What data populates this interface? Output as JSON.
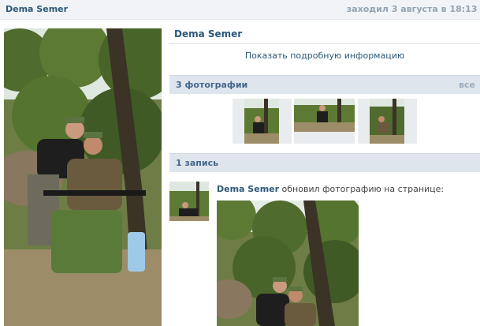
{
  "topbar": {
    "name": "Dema Semer",
    "last_seen": "заходил 3 августа в 18:13 б"
  },
  "profile": {
    "name": "Dema Semer",
    "more_info_link": "Показать подробную информацию"
  },
  "photos_section": {
    "title": "3 фотографии",
    "all_link": "все"
  },
  "posts_section": {
    "title": "1 запись"
  },
  "post": {
    "author": "Dema Semer",
    "action": "обновил фотографию на странице:"
  }
}
